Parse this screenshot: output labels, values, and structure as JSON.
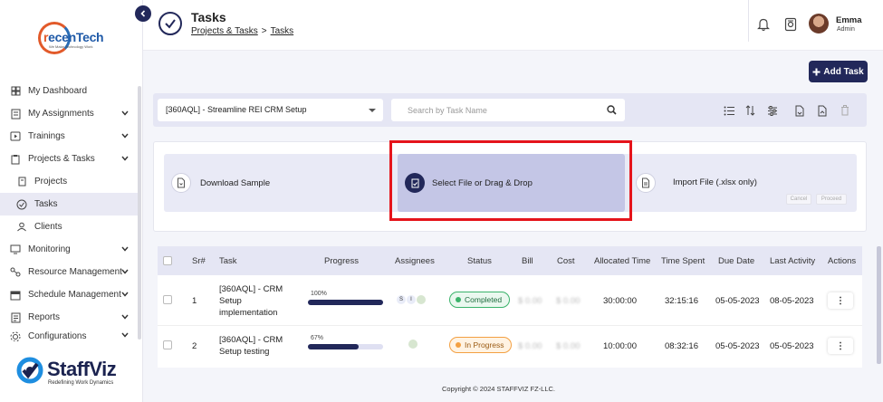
{
  "brand": {
    "company_logo_text": "recenTech",
    "company_logo_tagline": "We Make Technology Work",
    "product_name": "StaffViz",
    "product_tagline": "Redefining Work Dynamics"
  },
  "sidebar": {
    "items": [
      {
        "label": "My Dashboard",
        "icon": "dashboard-icon",
        "expandable": false
      },
      {
        "label": "My Assignments",
        "icon": "assignments-icon",
        "expandable": true
      },
      {
        "label": "Trainings",
        "icon": "trainings-icon",
        "expandable": true
      },
      {
        "label": "Projects & Tasks",
        "icon": "projects-tasks-icon",
        "expandable": true
      },
      {
        "label": "Projects",
        "icon": "projects-icon",
        "expandable": false,
        "sub": true
      },
      {
        "label": "Tasks",
        "icon": "tasks-icon",
        "expandable": false,
        "sub": true,
        "active": true
      },
      {
        "label": "Clients",
        "icon": "clients-icon",
        "expandable": false,
        "sub": true
      },
      {
        "label": "Monitoring",
        "icon": "monitoring-icon",
        "expandable": true
      },
      {
        "label": "Resource Management",
        "icon": "resource-icon",
        "expandable": true
      },
      {
        "label": "Schedule Management",
        "icon": "schedule-icon",
        "expandable": true
      },
      {
        "label": "Reports",
        "icon": "reports-icon",
        "expandable": true
      },
      {
        "label": "Configurations",
        "icon": "configurations-icon",
        "expandable": true
      }
    ]
  },
  "header": {
    "title": "Tasks",
    "breadcrumb": [
      "Projects & Tasks",
      "Tasks"
    ],
    "breadcrumb_sep": ">",
    "user_name": "Emma",
    "user_role": "Admin"
  },
  "toolbar": {
    "add_task_label": "Add Task",
    "project_selected": "[360AQL] - Streamline REI CRM Setup",
    "search_placeholder": "Search by Task Name"
  },
  "import": {
    "download_label": "Download Sample",
    "select_label": "Select File or Drag & Drop",
    "import_label": "Import File (.xlsx only)",
    "cancel_label": "Cancel",
    "proceed_label": "Proceed"
  },
  "table": {
    "columns": [
      "Sr#",
      "Task",
      "Progress",
      "Assignees",
      "Status",
      "Bill",
      "Cost",
      "Allocated Time",
      "Time Spent",
      "Due Date",
      "Last Activity",
      "Actions"
    ],
    "rows": [
      {
        "sr": "1",
        "task": "[360AQL] - CRM Setup implementation",
        "progress_label": "100%",
        "progress": 1.0,
        "assignees": [
          "S",
          "I",
          "avatar"
        ],
        "status": "Completed",
        "bill": "$ 0.00",
        "cost": "$ 0.00",
        "allocated": "30:00:00",
        "spent": "32:15:16",
        "due": "05-05-2023",
        "last_activity": "08-05-2023",
        "action": "⋮"
      },
      {
        "sr": "2",
        "task": "[360AQL] - CRM Setup testing",
        "progress_label": "67%",
        "progress": 0.67,
        "assignees": [
          "avatar"
        ],
        "status": "In Progress",
        "bill": "$ 0.00",
        "cost": "$ 0.00",
        "allocated": "10:00:00",
        "spent": "08:32:16",
        "due": "05-05-2023",
        "last_activity": "05-05-2023",
        "action": "⋮"
      }
    ]
  },
  "footer": {
    "copyright": "Copyright © 2024 STAFFVIZ FZ-LLC."
  },
  "colors": {
    "primary": "#22285a",
    "highlight": "#e5141b",
    "completed": "#3bb36b",
    "in_progress": "#f3a042"
  }
}
